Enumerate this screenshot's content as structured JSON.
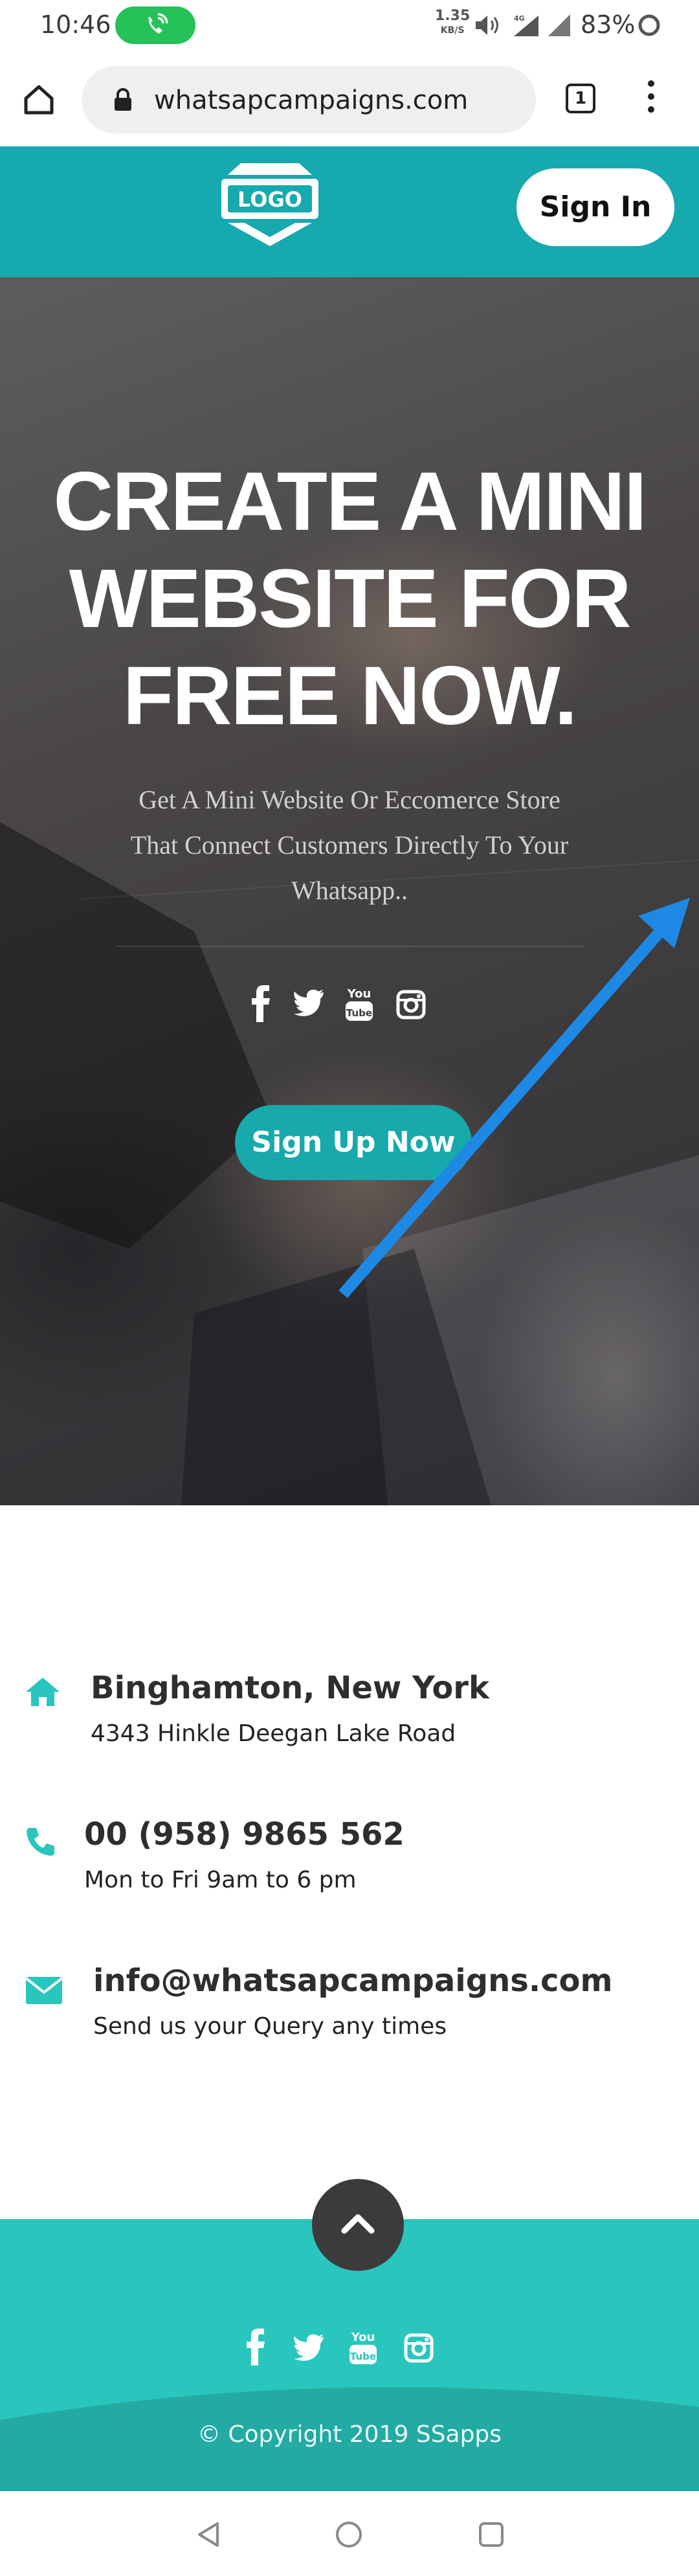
{
  "status_bar": {
    "time": "10:46",
    "net_speed_value": "1.35",
    "net_speed_unit": "KB/S",
    "network_type": "4G",
    "battery": "83%",
    "call_active_color": "#25c257"
  },
  "browser": {
    "url": "whatsapcampaigns.com",
    "tab_count": "1"
  },
  "site_header": {
    "logo_text": "LOGO",
    "sign_in_label": "Sign In",
    "bg_color": "#16a9ae"
  },
  "hero": {
    "title_lines": [
      "CREATE A MINI",
      "WEBSITE FOR",
      "FREE NOW."
    ],
    "subtitle_lines": [
      "Get A Mini Website Or Eccomerce Store",
      "That Connect Customers Directly To Your",
      "Whatsapp.."
    ],
    "social_icons": [
      "facebook-icon",
      "twitter-icon",
      "youtube-icon",
      "instagram-icon"
    ],
    "signup_label": "Sign Up Now",
    "accent_color": "#17a9ab",
    "annotation_arrow_color": "#1e88e5"
  },
  "contact": {
    "items": [
      {
        "icon": "home-icon",
        "title": "Binghamton, New York",
        "subtitle": "4343 Hinkle Deegan Lake Road"
      },
      {
        "icon": "phone-icon",
        "title": "00 (958) 9865 562",
        "subtitle": "Mon to Fri 9am to 6 pm"
      },
      {
        "icon": "envelope-icon",
        "title": "info@whatsapcampaigns.com",
        "subtitle": "Send us your Query any times"
      }
    ],
    "icon_color": "#29c6be"
  },
  "footer": {
    "social_icons": [
      "facebook-icon",
      "twitter-icon",
      "youtube-icon",
      "instagram-icon"
    ],
    "copyright": "© Copyright 2019 SSapps",
    "bg_color": "#29c6be"
  }
}
